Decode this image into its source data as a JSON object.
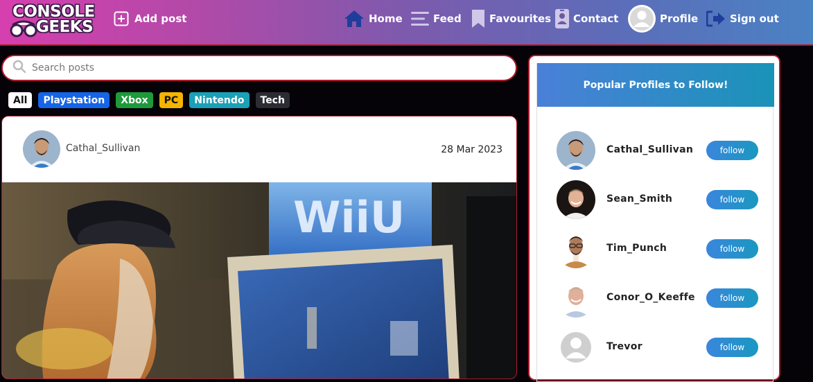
{
  "brand": {
    "line1": "CONSOLE",
    "line2": "GEEKS"
  },
  "nav": {
    "add_post": "Add post",
    "home": "Home",
    "feed": "Feed",
    "favourites": "Favourites",
    "contact": "Contact",
    "profile": "Profile",
    "sign_out": "Sign out"
  },
  "search": {
    "placeholder": "Search posts"
  },
  "filters": [
    {
      "label": "All",
      "color": "#ffffff",
      "text_color": "#111111"
    },
    {
      "label": "Playstation",
      "color": "#1565e8",
      "text_color": "#ffffff"
    },
    {
      "label": "Xbox",
      "color": "#1d9a3a",
      "text_color": "#ffffff"
    },
    {
      "label": "PC",
      "color": "#f5b400",
      "text_color": "#111111"
    },
    {
      "label": "Nintendo",
      "color": "#1aa0b8",
      "text_color": "#ffffff"
    },
    {
      "label": "Tech",
      "color": "#2b2d33",
      "text_color": "#ffffff"
    }
  ],
  "post": {
    "author": "Cathal_Sullivan",
    "date": "28 Mar 2023",
    "image_sign": "WiiU"
  },
  "sidebar": {
    "title": "Popular Profiles to Follow!",
    "follow_label": "follow",
    "profiles": [
      {
        "name": "Cathal_Sullivan"
      },
      {
        "name": "Sean_Smith"
      },
      {
        "name": "Tim_Punch"
      },
      {
        "name": "Conor_O_Keeffe"
      },
      {
        "name": "Trevor"
      }
    ]
  },
  "colors": {
    "accent_border": "#b11a2c",
    "page_background": "#050208",
    "follow_button": "#2a8fd0"
  }
}
